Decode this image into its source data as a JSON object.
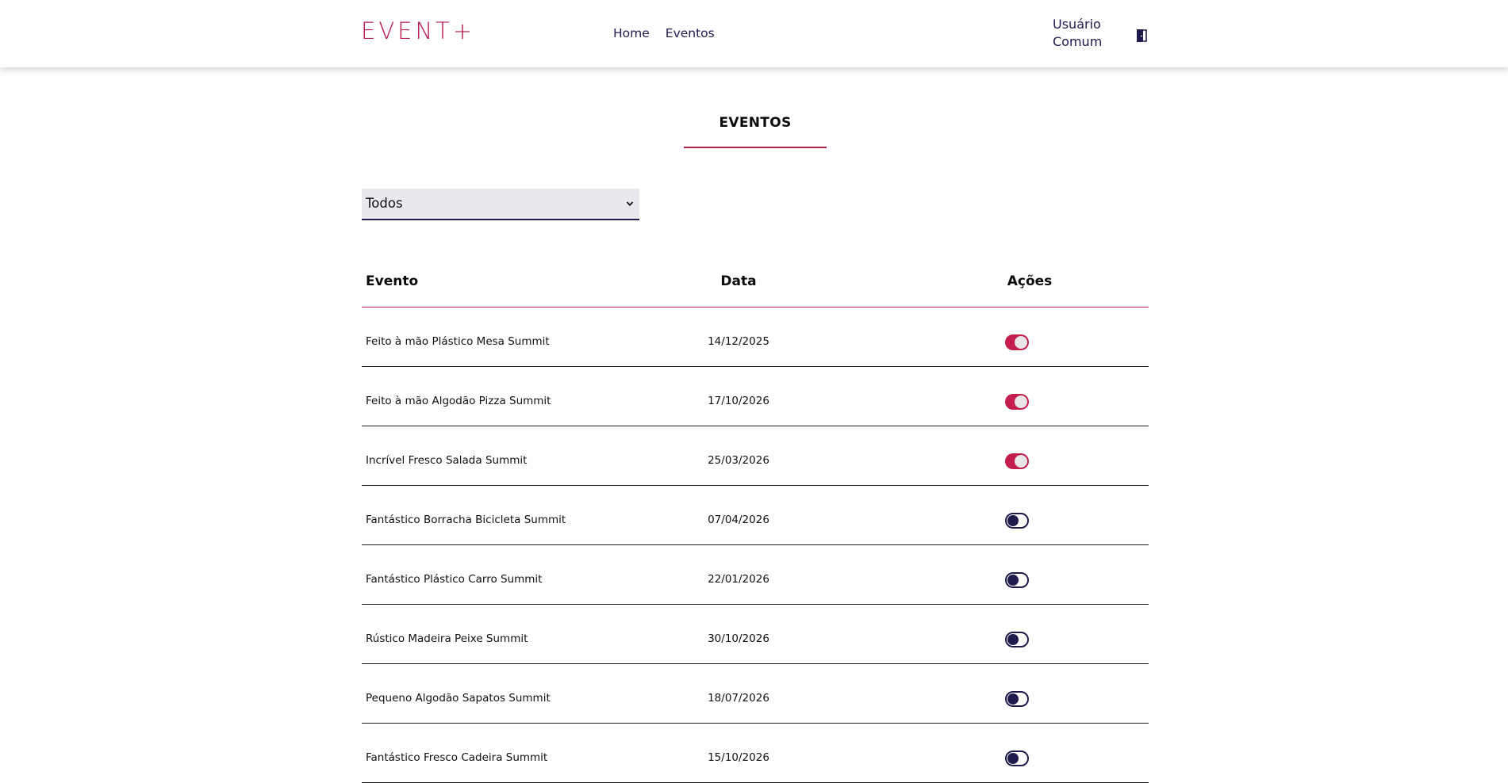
{
  "header": {
    "logo": "EVENT+",
    "nav": [
      {
        "label": "Home"
      },
      {
        "label": "Eventos"
      }
    ],
    "user": {
      "line1": "Usuário",
      "line2": "Comum"
    },
    "logout_icon": "door-exit-icon"
  },
  "main": {
    "title": "EVENTOS",
    "filter": {
      "selected": "Todos"
    },
    "table": {
      "headers": {
        "event": "Evento",
        "date": "Data",
        "actions": "Ações"
      },
      "rows": [
        {
          "event": "Feito à mão Plástico Mesa Summit",
          "date": "14/12/2025",
          "active": true
        },
        {
          "event": "Feito à mão Algodão Pizza Summit",
          "date": "17/10/2026",
          "active": true
        },
        {
          "event": "Incrível Fresco Salada Summit",
          "date": "25/03/2026",
          "active": true
        },
        {
          "event": "Fantástico Borracha Bicicleta Summit",
          "date": "07/04/2026",
          "active": false
        },
        {
          "event": "Fantástico Plástico Carro Summit",
          "date": "22/01/2026",
          "active": false
        },
        {
          "event": "Rústico Madeira Peixe Summit",
          "date": "30/10/2026",
          "active": false
        },
        {
          "event": "Pequeno Algodão Sapatos Summit",
          "date": "18/07/2026",
          "active": false
        },
        {
          "event": "Fantástico Fresco Cadeira Summit",
          "date": "15/10/2026",
          "active": false
        }
      ]
    }
  },
  "colors": {
    "accent": "#b51d4a",
    "toggle_on": "#c41e4c",
    "navy": "#1f1b4d",
    "select_bg": "#e9e8ee"
  }
}
